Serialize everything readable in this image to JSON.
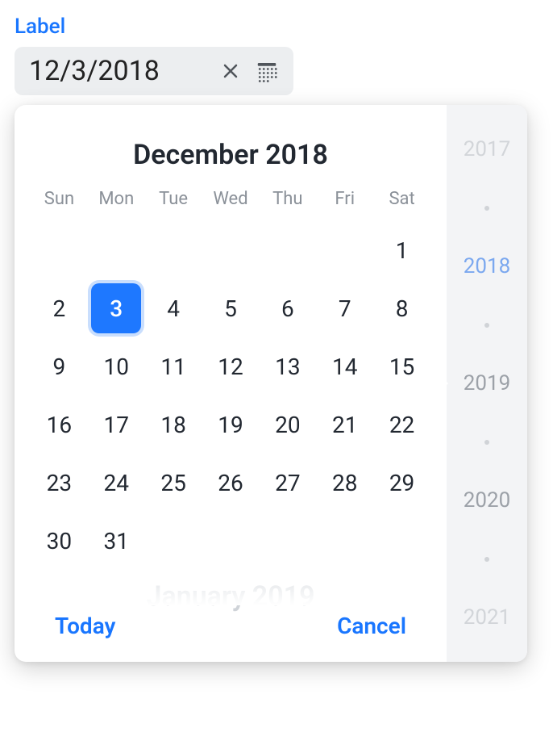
{
  "field": {
    "label": "Label",
    "value": "12/3/2018"
  },
  "calendar": {
    "month_title": "December 2018",
    "next_month_title": "January 2019",
    "weekdays": [
      "Sun",
      "Mon",
      "Tue",
      "Wed",
      "Thu",
      "Fri",
      "Sat"
    ],
    "leading_blanks": 6,
    "days_in_month": 31,
    "selected_day": 3
  },
  "actions": {
    "today": "Today",
    "cancel": "Cancel"
  },
  "year_rail": {
    "years": [
      "2017",
      "2018",
      "2019",
      "2020",
      "2021"
    ],
    "selected": "2018"
  },
  "colors": {
    "accent": "#1976ff",
    "selected_day_bg": "#1e78ff"
  }
}
